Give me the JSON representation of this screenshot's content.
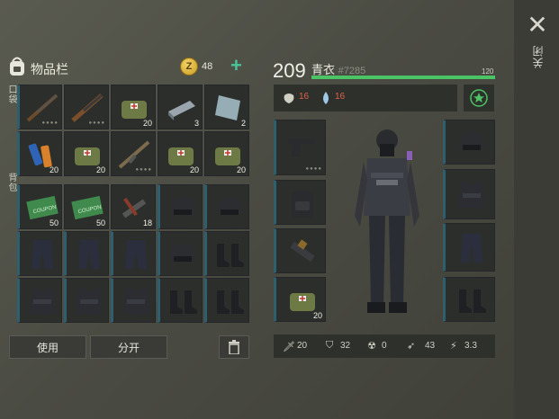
{
  "inventory": {
    "title": "物品栏",
    "coins": "48",
    "pocket_label": "口袋",
    "backpack_label": "背包"
  },
  "close_label": "关闭",
  "slots": [
    {
      "name": "rifle-slot",
      "qty": "",
      "dots": "●●●●"
    },
    {
      "name": "shotgun-slot",
      "qty": "",
      "dots": "●●●●"
    },
    {
      "name": "medkit-bag-slot-1",
      "qty": "20"
    },
    {
      "name": "metal-bar-slot",
      "qty": "3"
    },
    {
      "name": "glass-slot",
      "qty": "2"
    },
    {
      "name": "batteries-slot",
      "qty": "20"
    },
    {
      "name": "medkit-bag-slot-2",
      "qty": "20"
    },
    {
      "name": "assault-rifle-slot",
      "qty": "",
      "dots": "●●●●"
    },
    {
      "name": "medkit-bag-slot-3",
      "qty": "20"
    },
    {
      "name": "medkit-bag-slot-4",
      "qty": "20"
    },
    {
      "name": "ration-coupon-slot-1",
      "qty": "50",
      "text": "COUPON"
    },
    {
      "name": "ration-coupon-slot-2",
      "qty": "50",
      "text": "COUPON"
    },
    {
      "name": "weapon-parts-slot",
      "qty": "18"
    },
    {
      "name": "helmet-slot-1",
      "qty": ""
    },
    {
      "name": "helmet-slot-2",
      "qty": ""
    },
    {
      "name": "pants-slot-1",
      "qty": ""
    },
    {
      "name": "pants-slot-2",
      "qty": ""
    },
    {
      "name": "pants-slot-3",
      "qty": ""
    },
    {
      "name": "helmet-slot-3",
      "qty": ""
    },
    {
      "name": "boots-slot-1",
      "qty": ""
    },
    {
      "name": "vest-slot-1",
      "qty": ""
    },
    {
      "name": "vest-slot-2",
      "qty": ""
    },
    {
      "name": "vest-slot-3",
      "qty": ""
    },
    {
      "name": "boots-slot-2",
      "qty": ""
    },
    {
      "name": "boots-slot-3",
      "qty": ""
    }
  ],
  "buttons": {
    "use": "使用",
    "split": "分开"
  },
  "character": {
    "level": "209",
    "name": "青衣",
    "id": "#7285",
    "xp_max": "120",
    "xp_fraction": 1.0,
    "hunger": "16",
    "thirst": "16"
  },
  "equipment": {
    "weapon_dots": "●●●●",
    "consumable_qty": "20"
  },
  "stats": {
    "attack": "20",
    "defense": "32",
    "radiation": "0",
    "speed": "43",
    "stealth": "3.3"
  },
  "colors": {
    "accent_green": "#4bc465",
    "add_green": "#49c49a",
    "status_red": "#e0614d",
    "slot_accent": "#2d5f6e"
  }
}
